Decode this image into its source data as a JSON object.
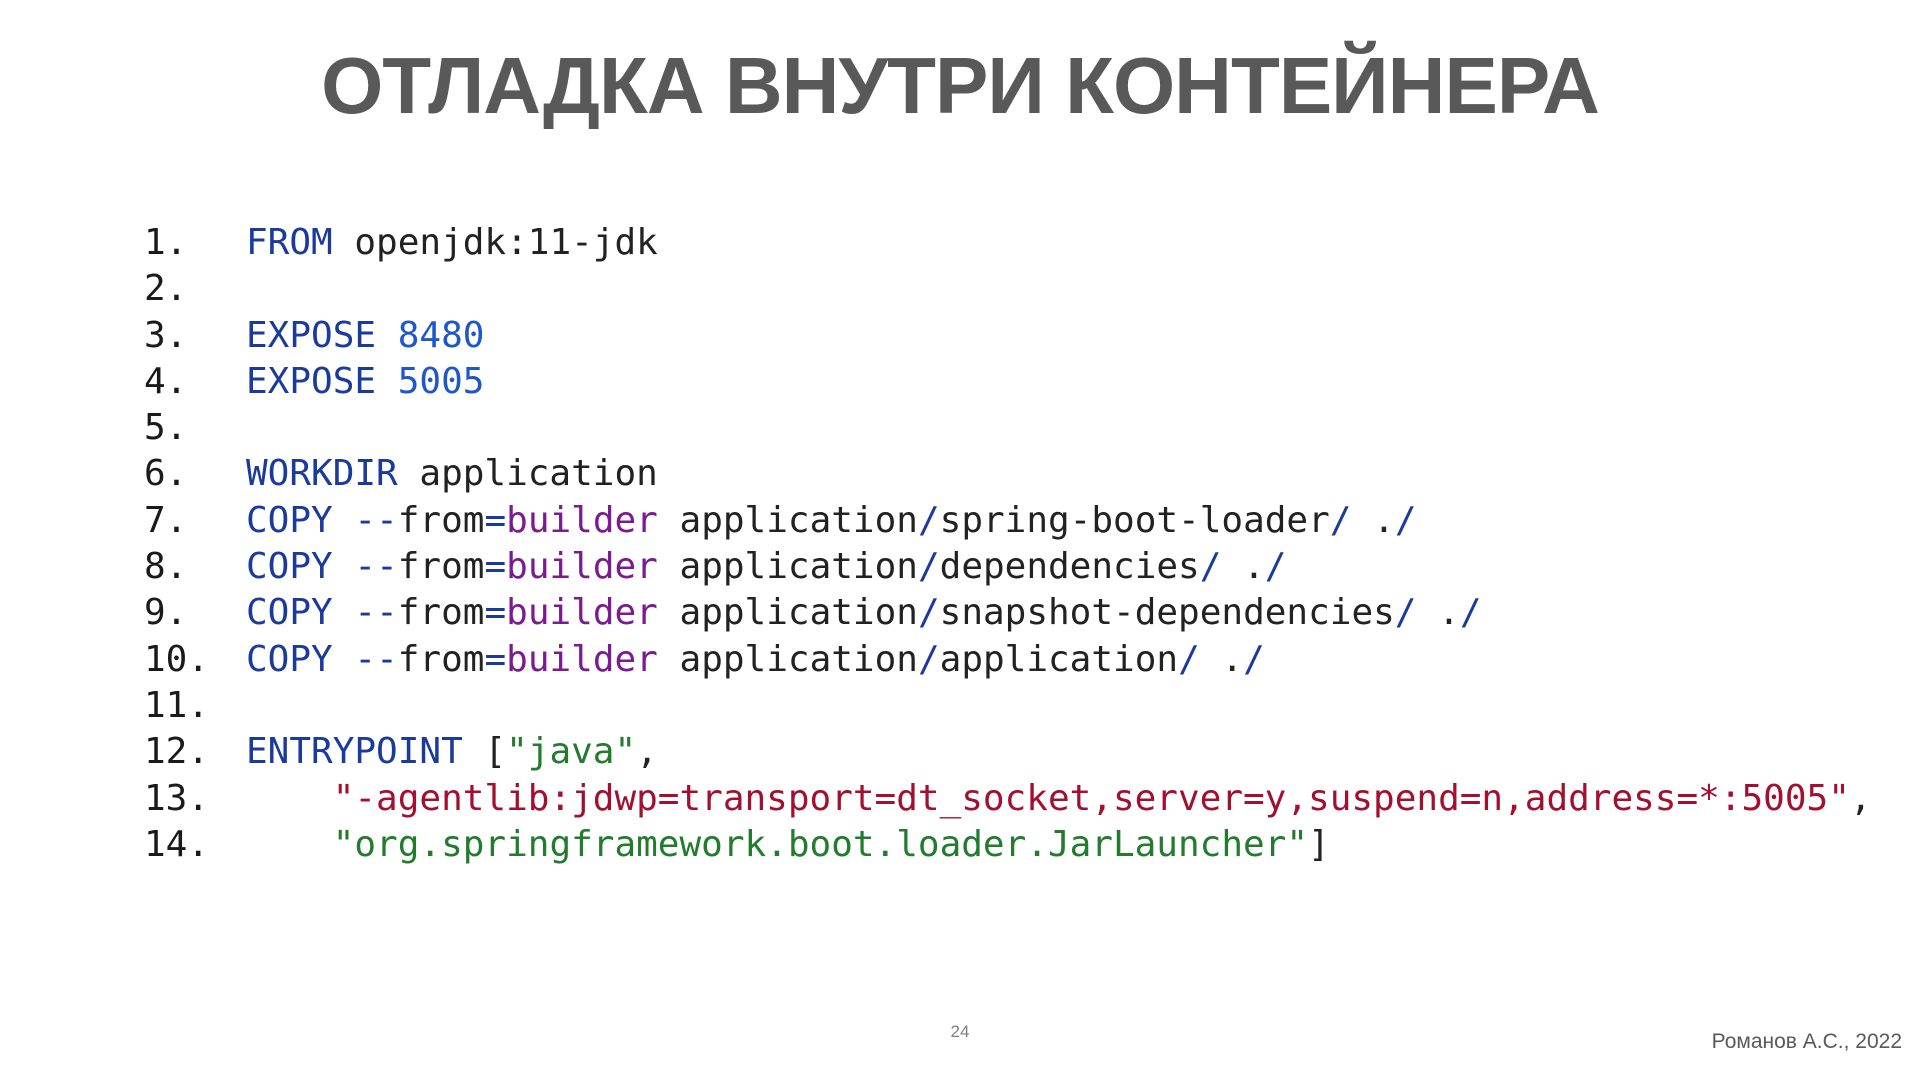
{
  "slide": {
    "title": "ОТЛАДКА ВНУТРИ КОНТЕЙНЕРА",
    "page_number": "24",
    "author": "Романов А.С., 2022"
  },
  "colors": {
    "title": "#595959",
    "keyword": "#1a3a9c",
    "number": "#1f57c9",
    "reference": "#7a1b8f",
    "string_red": "#a3102f",
    "string_green": "#237b2e",
    "text": "#222222"
  },
  "code": {
    "lines": [
      {
        "num": "1.",
        "tokens": [
          {
            "t": "FROM",
            "c": "kw"
          },
          {
            "t": " openjdk:11-jdk",
            "c": "plain"
          }
        ]
      },
      {
        "num": "2.",
        "tokens": []
      },
      {
        "num": "3.",
        "tokens": [
          {
            "t": "EXPOSE",
            "c": "kw"
          },
          {
            "t": " ",
            "c": "plain"
          },
          {
            "t": "8480",
            "c": "num"
          }
        ]
      },
      {
        "num": "4.",
        "tokens": [
          {
            "t": "EXPOSE",
            "c": "kw"
          },
          {
            "t": " ",
            "c": "plain"
          },
          {
            "t": "5005",
            "c": "num"
          }
        ]
      },
      {
        "num": "5.",
        "tokens": []
      },
      {
        "num": "6.",
        "tokens": [
          {
            "t": "WORKDIR",
            "c": "kw"
          },
          {
            "t": " application",
            "c": "plain"
          }
        ]
      },
      {
        "num": "7.",
        "tokens": [
          {
            "t": "COPY",
            "c": "kw"
          },
          {
            "t": " ",
            "c": "plain"
          },
          {
            "t": "--",
            "c": "flag"
          },
          {
            "t": "from",
            "c": "plain"
          },
          {
            "t": "=",
            "c": "flag"
          },
          {
            "t": "builder",
            "c": "ref"
          },
          {
            "t": " application",
            "c": "path"
          },
          {
            "t": "/",
            "c": "slash"
          },
          {
            "t": "spring-boot-loader",
            "c": "path"
          },
          {
            "t": "/",
            "c": "slash"
          },
          {
            "t": " .",
            "c": "path"
          },
          {
            "t": "/",
            "c": "slash"
          }
        ]
      },
      {
        "num": "8.",
        "tokens": [
          {
            "t": "COPY",
            "c": "kw"
          },
          {
            "t": " ",
            "c": "plain"
          },
          {
            "t": "--",
            "c": "flag"
          },
          {
            "t": "from",
            "c": "plain"
          },
          {
            "t": "=",
            "c": "flag"
          },
          {
            "t": "builder",
            "c": "ref"
          },
          {
            "t": " application",
            "c": "path"
          },
          {
            "t": "/",
            "c": "slash"
          },
          {
            "t": "dependencies",
            "c": "path"
          },
          {
            "t": "/",
            "c": "slash"
          },
          {
            "t": " .",
            "c": "path"
          },
          {
            "t": "/",
            "c": "slash"
          }
        ]
      },
      {
        "num": "9.",
        "tokens": [
          {
            "t": "COPY",
            "c": "kw"
          },
          {
            "t": " ",
            "c": "plain"
          },
          {
            "t": "--",
            "c": "flag"
          },
          {
            "t": "from",
            "c": "plain"
          },
          {
            "t": "=",
            "c": "flag"
          },
          {
            "t": "builder",
            "c": "ref"
          },
          {
            "t": " application",
            "c": "path"
          },
          {
            "t": "/",
            "c": "slash"
          },
          {
            "t": "snapshot-dependencies",
            "c": "path"
          },
          {
            "t": "/",
            "c": "slash"
          },
          {
            "t": " .",
            "c": "path"
          },
          {
            "t": "/",
            "c": "slash"
          }
        ]
      },
      {
        "num": "10.",
        "tokens": [
          {
            "t": "COPY",
            "c": "kw"
          },
          {
            "t": " ",
            "c": "plain"
          },
          {
            "t": "--",
            "c": "flag"
          },
          {
            "t": "from",
            "c": "plain"
          },
          {
            "t": "=",
            "c": "flag"
          },
          {
            "t": "builder",
            "c": "ref"
          },
          {
            "t": " application",
            "c": "path"
          },
          {
            "t": "/",
            "c": "slash"
          },
          {
            "t": "application",
            "c": "path"
          },
          {
            "t": "/",
            "c": "slash"
          },
          {
            "t": " .",
            "c": "path"
          },
          {
            "t": "/",
            "c": "slash"
          }
        ]
      },
      {
        "num": "11.",
        "tokens": []
      },
      {
        "num": "12.",
        "tokens": [
          {
            "t": "ENTRYPOINT",
            "c": "kw"
          },
          {
            "t": " [",
            "c": "punct"
          },
          {
            "t": "\"java\"",
            "c": "str-green"
          },
          {
            "t": ",",
            "c": "punct"
          }
        ]
      },
      {
        "num": "13.",
        "tokens": [
          {
            "t": "    ",
            "c": "plain"
          },
          {
            "t": "\"-agentlib:jdwp=transport=dt_socket,server=y,suspend=n,address=*:5005\"",
            "c": "str-red"
          },
          {
            "t": ",",
            "c": "punct"
          }
        ]
      },
      {
        "num": "14.",
        "tokens": [
          {
            "t": "    ",
            "c": "plain"
          },
          {
            "t": "\"org.springframework.boot.loader.JarLauncher\"",
            "c": "str-green"
          },
          {
            "t": "]",
            "c": "punct"
          }
        ]
      }
    ]
  }
}
